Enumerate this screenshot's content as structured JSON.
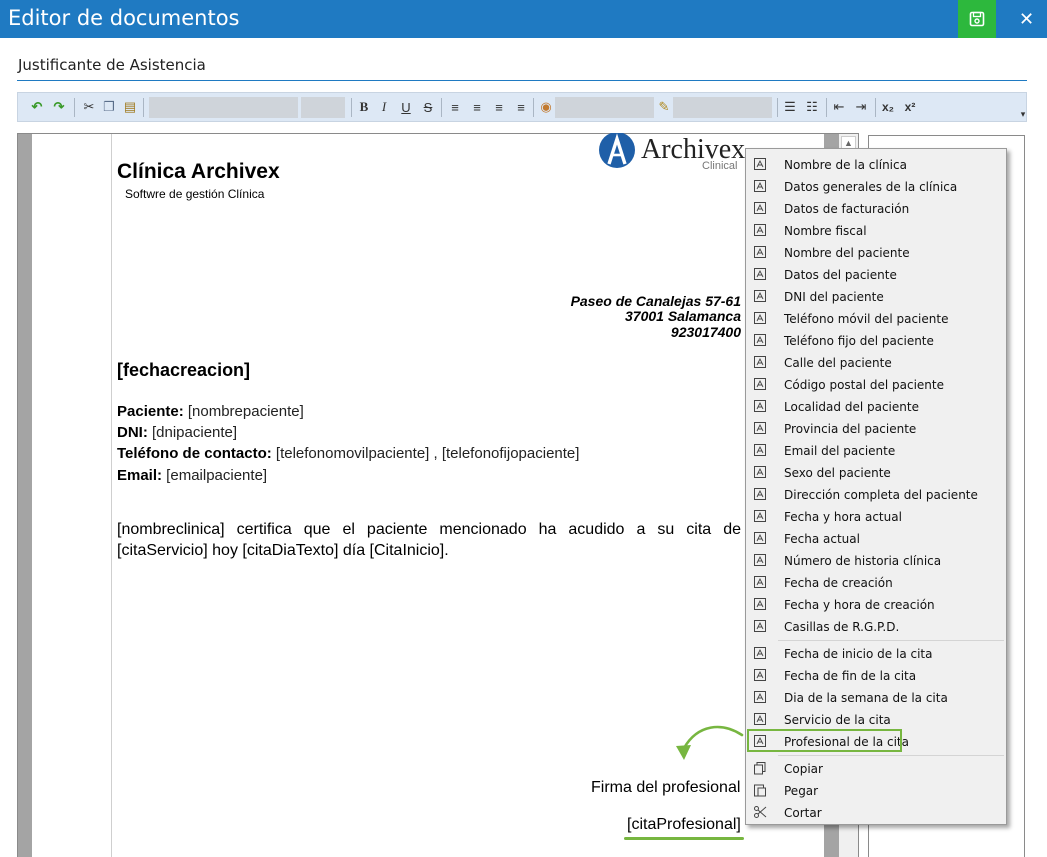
{
  "window": {
    "title": "Editor de documentos"
  },
  "document": {
    "name": "Justificante de Asistencia"
  },
  "letter": {
    "clinic_name": "Clínica Archivex",
    "clinic_subtitle": "Softwre de gestión Clínica",
    "logo_text": "Archivex",
    "logo_sub": "Clinical",
    "address_line1": "Paseo de Canalejas 57-61",
    "address_line2": "37001 Salamanca",
    "address_line3": "923017400",
    "fecha": "[fechacreacion]",
    "fields": [
      {
        "label": "Paciente:",
        "value": " [nombrepaciente]"
      },
      {
        "label": "DNI:",
        "value": " [dnipaciente]"
      },
      {
        "label": "Teléfono de contacto:",
        "value": " [telefonomovilpaciente] , [telefonofijopaciente]"
      },
      {
        "label": "Email:",
        "value": " [emailpaciente]"
      }
    ],
    "body": "[nombreclinica] certifica que el paciente mencionado ha acudido a su cita de [citaServicio] hoy [citaDiaTexto] día [CitaInicio].",
    "signature_label": "Firma del profesional",
    "signature_field": "[citaProfesional]"
  },
  "context_menu": {
    "group1": [
      "Nombre de la clínica",
      "Datos generales de la clínica",
      "Datos de facturación",
      "Nombre fiscal",
      "Nombre del paciente",
      "Datos del paciente",
      "DNI del paciente",
      "Teléfono móvil del paciente",
      "Teléfono fijo del paciente",
      "Calle del paciente",
      "Código postal del paciente",
      "Localidad del paciente",
      "Provincia del paciente",
      "Email del paciente",
      "Sexo del paciente",
      "Dirección completa del paciente",
      "Fecha y hora actual",
      "Fecha actual",
      "Número de historia clínica",
      "Fecha de creación",
      "Fecha y hora de creación",
      "Casillas de R.G.P.D."
    ],
    "group2": [
      "Fecha de inicio de la cita",
      "Fecha de fin de la cita",
      "Dia de la semana de la cita",
      "Servicio de la cita",
      "Profesional de la cita"
    ],
    "group3": [
      {
        "label": "Copiar",
        "icon": "copy-icon"
      },
      {
        "label": "Pegar",
        "icon": "paste-icon"
      },
      {
        "label": "Cortar",
        "icon": "cut-icon"
      }
    ],
    "highlighted": "Profesional de la cita"
  },
  "colors": {
    "titlebar": "#1f7ac2",
    "save": "#2db83d",
    "highlight": "#77b640"
  }
}
